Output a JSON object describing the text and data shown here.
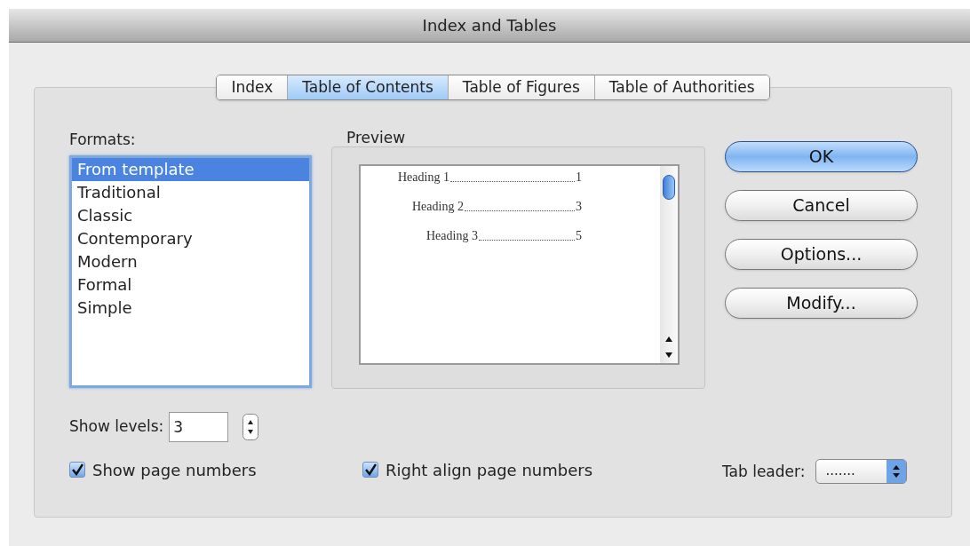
{
  "window": {
    "title": "Index and Tables"
  },
  "tabs": [
    {
      "label": "Index",
      "selected": false
    },
    {
      "label": "Table of Contents",
      "selected": true
    },
    {
      "label": "Table of Figures",
      "selected": false
    },
    {
      "label": "Table of Authorities",
      "selected": false
    }
  ],
  "formats": {
    "label": "Formats:",
    "items": [
      {
        "label": "From template",
        "selected": true
      },
      {
        "label": "Traditional",
        "selected": false
      },
      {
        "label": "Classic",
        "selected": false
      },
      {
        "label": "Contemporary",
        "selected": false
      },
      {
        "label": "Modern",
        "selected": false
      },
      {
        "label": "Formal",
        "selected": false
      },
      {
        "label": "Simple",
        "selected": false
      }
    ]
  },
  "preview": {
    "label": "Preview",
    "entries": [
      {
        "text": "Heading 1",
        "page": "1",
        "children": [
          {
            "text": "Heading 2",
            "page": "3",
            "children": [
              {
                "text": "Heading 3",
                "page": "5"
              }
            ]
          }
        ]
      }
    ]
  },
  "buttons": [
    {
      "label": "OK",
      "default": true
    },
    {
      "label": "Cancel",
      "default": false
    },
    {
      "label": "Options...",
      "default": false
    },
    {
      "label": "Modify...",
      "default": false
    }
  ],
  "show_levels": {
    "label": "Show levels:",
    "value": "3"
  },
  "checkboxes": [
    {
      "label": "Show page numbers",
      "checked": true
    },
    {
      "label": "Right align page numbers",
      "checked": true
    }
  ],
  "tab_leader": {
    "label": "Tab leader:",
    "value": "......."
  }
}
